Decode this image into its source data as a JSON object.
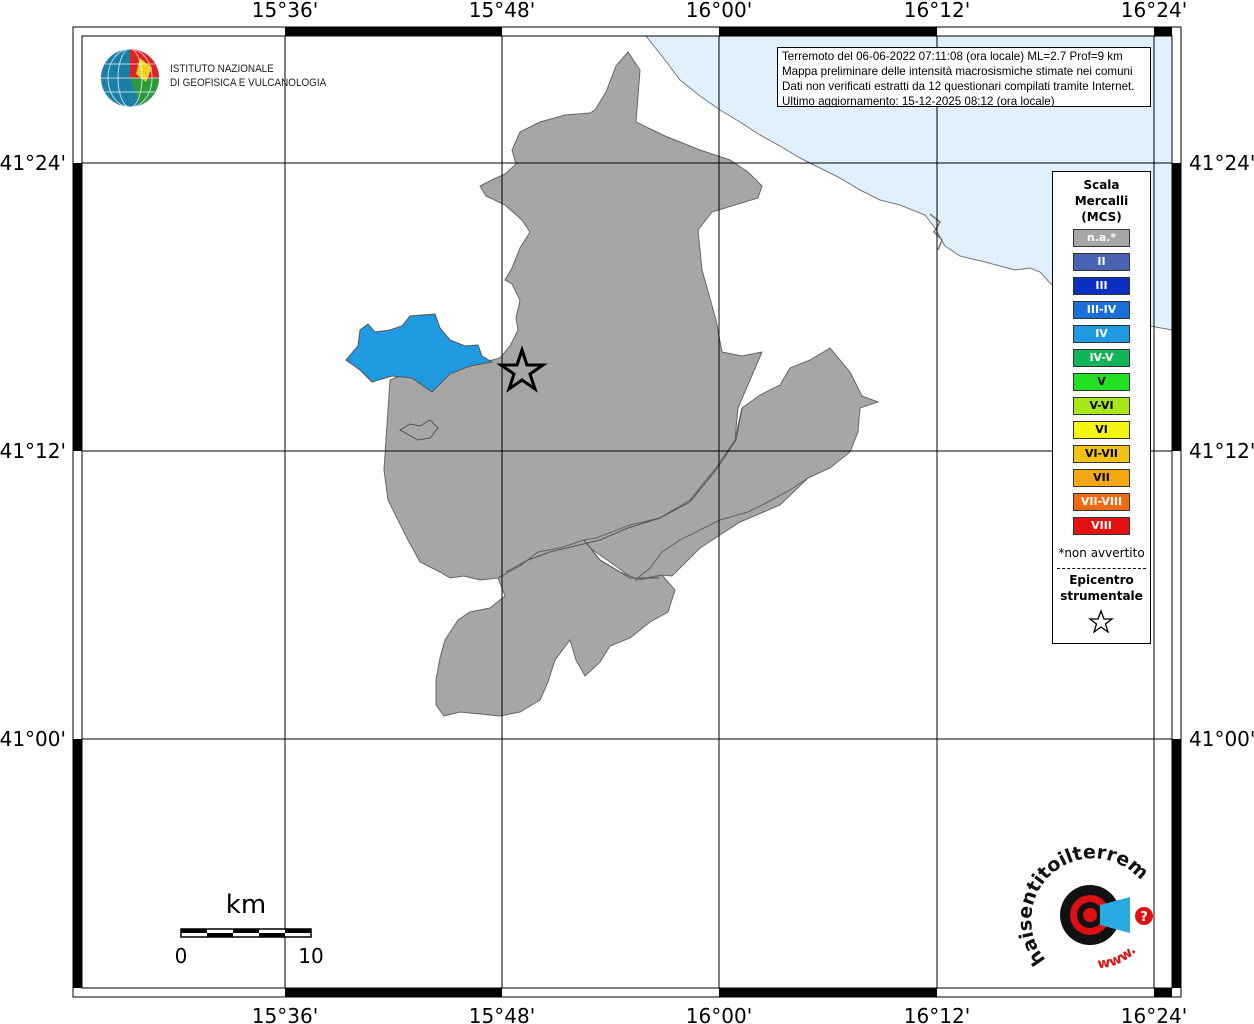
{
  "map": {
    "top_longitude_labels": [
      "15°36'",
      "15°48'",
      "16°00'",
      "16°12'",
      "16°24'"
    ],
    "bottom_longitude_labels": [
      "15°36'",
      "15°48'",
      "16°00'",
      "16°12'",
      "16°24'"
    ],
    "left_latitude_labels": [
      "41°24'",
      "41°12'",
      "41°00'"
    ],
    "right_latitude_labels": [
      "41°24'",
      "41°12'",
      "41°00'"
    ],
    "colors": {
      "sea": "#e0f0fc",
      "municipality_not_felt": "#a6a6a6",
      "municipality_intensity_IV": "#1f9ae0",
      "grid_line": "#000000"
    },
    "epicenter_icon": "star-icon"
  },
  "info": {
    "line1": "Terremoto del 06-06-2022 07:11:08 (ora locale) ML=2.7 Prof=9 km",
    "line2": "Mappa preliminare delle intensità macrosismiche stimate nei comuni",
    "line3": "Dati non verificati estratti da 12 questionari compilati tramite Internet.",
    "line4": "Ultimo aggiornamento: 15-12-2025 08:12 (ora locale)"
  },
  "legend": {
    "title_line1": "Scala",
    "title_line2": "Mercalli",
    "title_line3": "(MCS)",
    "items": [
      {
        "label": "n.a.*",
        "color": "#a6a6a6"
      },
      {
        "label": "II",
        "color": "#4a64b4"
      },
      {
        "label": "III",
        "color": "#0b2fc0"
      },
      {
        "label": "III-IV",
        "color": "#1a6fd8"
      },
      {
        "label": "IV",
        "color": "#1f9ae0"
      },
      {
        "label": "IV-V",
        "color": "#12b45a"
      },
      {
        "label": "V",
        "color": "#22e022"
      },
      {
        "label": "V-VI",
        "color": "#a8e81a"
      },
      {
        "label": "VI",
        "color": "#f5f512"
      },
      {
        "label": "VI-VII",
        "color": "#f5c212"
      },
      {
        "label": "VII",
        "color": "#f5a812"
      },
      {
        "label": "VII-VIII",
        "color": "#f26a12"
      },
      {
        "label": "VIII",
        "color": "#e61212"
      }
    ],
    "note": "*non avvertito",
    "epicenter_line1": "Epicentro",
    "epicenter_line2": "strumentale"
  },
  "ingv": {
    "line1": "ISTITUTO NAZIONALE",
    "line2": "DI GEOFISICA E VULCANOLOGIA"
  },
  "scalebar": {
    "unit": "km",
    "start": "0",
    "end": "10"
  },
  "hsit": {
    "brand": "haisentitoilterremoto.it",
    "url_text": "www."
  }
}
